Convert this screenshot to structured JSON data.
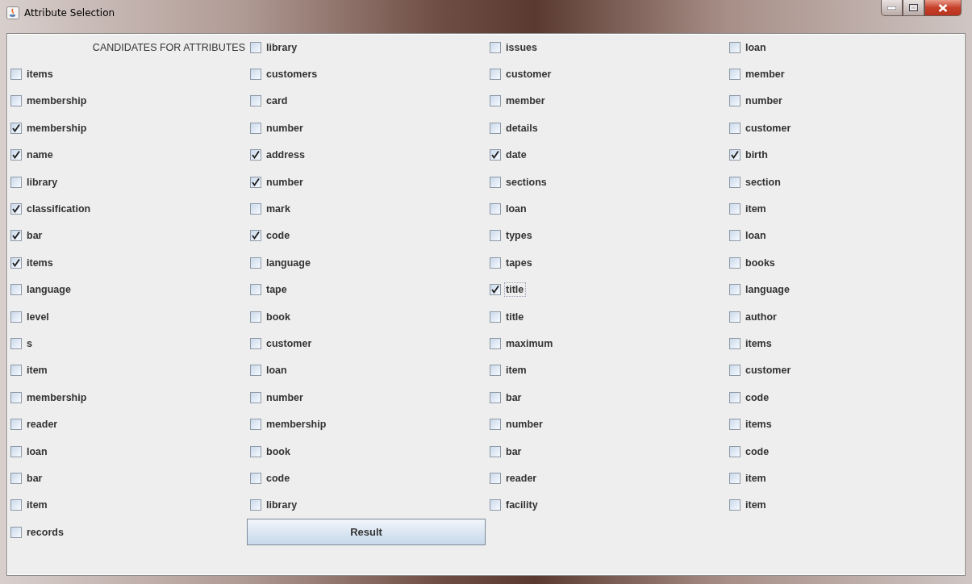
{
  "window": {
    "title": "Attribute Selection"
  },
  "cells": [
    {
      "kind": "label",
      "text": "CANDIDATES FOR ATTRIBUTES"
    },
    {
      "kind": "checkbox",
      "label": "library",
      "checked": false,
      "focused": false
    },
    {
      "kind": "checkbox",
      "label": "issues",
      "checked": false,
      "focused": false
    },
    {
      "kind": "checkbox",
      "label": "loan",
      "checked": false,
      "focused": false
    },
    {
      "kind": "checkbox",
      "label": "items",
      "checked": false,
      "focused": false
    },
    {
      "kind": "checkbox",
      "label": "customers",
      "checked": false,
      "focused": false
    },
    {
      "kind": "checkbox",
      "label": "customer",
      "checked": false,
      "focused": false
    },
    {
      "kind": "checkbox",
      "label": "member",
      "checked": false,
      "focused": false
    },
    {
      "kind": "checkbox",
      "label": "membership",
      "checked": false,
      "focused": false
    },
    {
      "kind": "checkbox",
      "label": "card",
      "checked": false,
      "focused": false
    },
    {
      "kind": "checkbox",
      "label": "member",
      "checked": false,
      "focused": false
    },
    {
      "kind": "checkbox",
      "label": "number",
      "checked": false,
      "focused": false
    },
    {
      "kind": "checkbox",
      "label": "membership",
      "checked": true,
      "focused": false
    },
    {
      "kind": "checkbox",
      "label": "number",
      "checked": false,
      "focused": false
    },
    {
      "kind": "checkbox",
      "label": "details",
      "checked": false,
      "focused": false
    },
    {
      "kind": "checkbox",
      "label": "customer",
      "checked": false,
      "focused": false
    },
    {
      "kind": "checkbox",
      "label": "name",
      "checked": true,
      "focused": false
    },
    {
      "kind": "checkbox",
      "label": "address",
      "checked": true,
      "focused": false
    },
    {
      "kind": "checkbox",
      "label": "date",
      "checked": true,
      "focused": false
    },
    {
      "kind": "checkbox",
      "label": "birth",
      "checked": true,
      "focused": false
    },
    {
      "kind": "checkbox",
      "label": "library",
      "checked": false,
      "focused": false
    },
    {
      "kind": "checkbox",
      "label": "number",
      "checked": true,
      "focused": false
    },
    {
      "kind": "checkbox",
      "label": "sections",
      "checked": false,
      "focused": false
    },
    {
      "kind": "checkbox",
      "label": "section",
      "checked": false,
      "focused": false
    },
    {
      "kind": "checkbox",
      "label": "classification",
      "checked": true,
      "focused": false
    },
    {
      "kind": "checkbox",
      "label": "mark",
      "checked": false,
      "focused": false
    },
    {
      "kind": "checkbox",
      "label": "loan",
      "checked": false,
      "focused": false
    },
    {
      "kind": "checkbox",
      "label": "item",
      "checked": false,
      "focused": false
    },
    {
      "kind": "checkbox",
      "label": "bar",
      "checked": true,
      "focused": false
    },
    {
      "kind": "checkbox",
      "label": "code",
      "checked": true,
      "focused": false
    },
    {
      "kind": "checkbox",
      "label": "types",
      "checked": false,
      "focused": false
    },
    {
      "kind": "checkbox",
      "label": "loan",
      "checked": false,
      "focused": false
    },
    {
      "kind": "checkbox",
      "label": "items",
      "checked": true,
      "focused": false
    },
    {
      "kind": "checkbox",
      "label": "language",
      "checked": false,
      "focused": false
    },
    {
      "kind": "checkbox",
      "label": "tapes",
      "checked": false,
      "focused": false
    },
    {
      "kind": "checkbox",
      "label": "books",
      "checked": false,
      "focused": false
    },
    {
      "kind": "checkbox",
      "label": "language",
      "checked": false,
      "focused": false
    },
    {
      "kind": "checkbox",
      "label": "tape",
      "checked": false,
      "focused": false
    },
    {
      "kind": "checkbox",
      "label": "title",
      "checked": true,
      "focused": true
    },
    {
      "kind": "checkbox",
      "label": "language",
      "checked": false,
      "focused": false
    },
    {
      "kind": "checkbox",
      "label": "level",
      "checked": false,
      "focused": false
    },
    {
      "kind": "checkbox",
      "label": "book",
      "checked": false,
      "focused": false
    },
    {
      "kind": "checkbox",
      "label": "title",
      "checked": false,
      "focused": false
    },
    {
      "kind": "checkbox",
      "label": "author",
      "checked": false,
      "focused": false
    },
    {
      "kind": "checkbox",
      "label": "s",
      "checked": false,
      "focused": false
    },
    {
      "kind": "checkbox",
      "label": "customer",
      "checked": false,
      "focused": false
    },
    {
      "kind": "checkbox",
      "label": "maximum",
      "checked": false,
      "focused": false
    },
    {
      "kind": "checkbox",
      "label": "items",
      "checked": false,
      "focused": false
    },
    {
      "kind": "checkbox",
      "label": "item",
      "checked": false,
      "focused": false
    },
    {
      "kind": "checkbox",
      "label": "loan",
      "checked": false,
      "focused": false
    },
    {
      "kind": "checkbox",
      "label": "item",
      "checked": false,
      "focused": false
    },
    {
      "kind": "checkbox",
      "label": "customer",
      "checked": false,
      "focused": false
    },
    {
      "kind": "checkbox",
      "label": "membership",
      "checked": false,
      "focused": false
    },
    {
      "kind": "checkbox",
      "label": "number",
      "checked": false,
      "focused": false
    },
    {
      "kind": "checkbox",
      "label": "bar",
      "checked": false,
      "focused": false
    },
    {
      "kind": "checkbox",
      "label": "code",
      "checked": false,
      "focused": false
    },
    {
      "kind": "checkbox",
      "label": "reader",
      "checked": false,
      "focused": false
    },
    {
      "kind": "checkbox",
      "label": "membership",
      "checked": false,
      "focused": false
    },
    {
      "kind": "checkbox",
      "label": "number",
      "checked": false,
      "focused": false
    },
    {
      "kind": "checkbox",
      "label": "items",
      "checked": false,
      "focused": false
    },
    {
      "kind": "checkbox",
      "label": "loan",
      "checked": false,
      "focused": false
    },
    {
      "kind": "checkbox",
      "label": "book",
      "checked": false,
      "focused": false
    },
    {
      "kind": "checkbox",
      "label": "bar",
      "checked": false,
      "focused": false
    },
    {
      "kind": "checkbox",
      "label": "code",
      "checked": false,
      "focused": false
    },
    {
      "kind": "checkbox",
      "label": "bar",
      "checked": false,
      "focused": false
    },
    {
      "kind": "checkbox",
      "label": "code",
      "checked": false,
      "focused": false
    },
    {
      "kind": "checkbox",
      "label": "reader",
      "checked": false,
      "focused": false
    },
    {
      "kind": "checkbox",
      "label": "item",
      "checked": false,
      "focused": false
    },
    {
      "kind": "checkbox",
      "label": "item",
      "checked": false,
      "focused": false
    },
    {
      "kind": "checkbox",
      "label": "library",
      "checked": false,
      "focused": false
    },
    {
      "kind": "checkbox",
      "label": "facility",
      "checked": false,
      "focused": false
    },
    {
      "kind": "checkbox",
      "label": "item",
      "checked": false,
      "focused": false
    },
    {
      "kind": "checkbox",
      "label": "records",
      "checked": false,
      "focused": false
    },
    {
      "kind": "button",
      "text": "Result"
    }
  ]
}
